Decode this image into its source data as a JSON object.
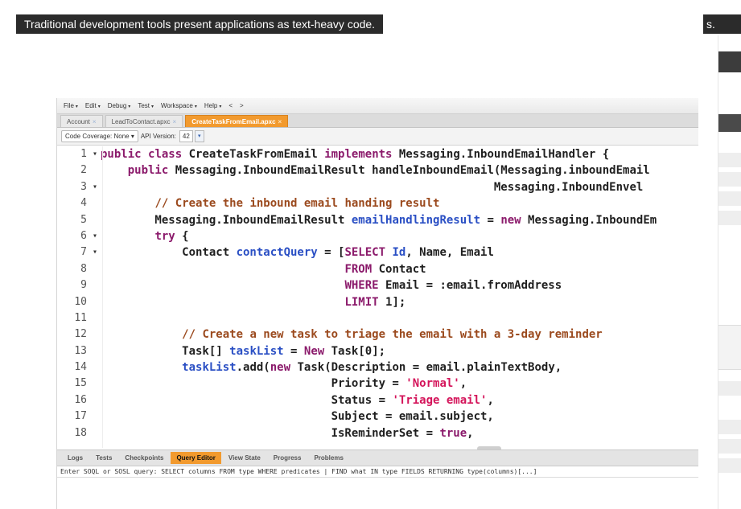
{
  "caption": {
    "text": "Traditional development tools present applications as text-heavy code.",
    "right_fragment": "s."
  },
  "menubar": {
    "items": [
      {
        "label": "File",
        "caret": "▾"
      },
      {
        "label": "Edit",
        "caret": "▾"
      },
      {
        "label": "Debug",
        "caret": "▾"
      },
      {
        "label": "Test",
        "caret": "▾"
      },
      {
        "label": "Workspace",
        "caret": "▾"
      },
      {
        "label": "Help",
        "caret": "▾"
      }
    ],
    "back_arrow": "<",
    "forward_arrow": ">"
  },
  "tabs": [
    {
      "label": "Account",
      "close": "×",
      "active": false
    },
    {
      "label": "LeadToContact.apxc",
      "close": "×",
      "active": false
    },
    {
      "label": "CreateTaskFromEmail.apxc",
      "close": "×",
      "active": true
    }
  ],
  "toolbar": {
    "coverage_select": "Code Coverage: None ▾",
    "api_label": "API Version:",
    "api_value": "42",
    "api_drop": "▾"
  },
  "code_lines": [
    {
      "n": "1",
      "fold": "▾",
      "text": "public class CreateTaskFromEmail implements Messaging.InboundEmailHandler {"
    },
    {
      "n": "2",
      "fold": "",
      "text": "    public Messaging.InboundEmailResult handleInboundEmail(Messaging.inboundEmail"
    },
    {
      "n": "3",
      "fold": "▾",
      "text": "                                                          Messaging.InboundEnvel"
    },
    {
      "n": "4",
      "fold": "",
      "text": "        // Create the inbound email handing result"
    },
    {
      "n": "5",
      "fold": "",
      "text": "        Messaging.InboundEmailResult emailHandlingResult = new Messaging.InboundEm"
    },
    {
      "n": "6",
      "fold": "▾",
      "text": "        try {"
    },
    {
      "n": "7",
      "fold": "▾",
      "text": "            Contact contactQuery = [SELECT Id, Name, Email"
    },
    {
      "n": "8",
      "fold": "",
      "text": "                                    FROM Contact"
    },
    {
      "n": "9",
      "fold": "",
      "text": "                                    WHERE Email = :email.fromAddress"
    },
    {
      "n": "10",
      "fold": "",
      "text": "                                    LIMIT 1];"
    },
    {
      "n": "11",
      "fold": "",
      "text": ""
    },
    {
      "n": "12",
      "fold": "",
      "text": "            // Create a new task to triage the email with a 3-day reminder"
    },
    {
      "n": "13",
      "fold": "",
      "text": "            Task[] taskList = New Task[0];"
    },
    {
      "n": "14",
      "fold": "",
      "text": "            taskList.add(new Task(Description = email.plainTextBody,"
    },
    {
      "n": "15",
      "fold": "",
      "text": "                                  Priority = 'Normal',"
    },
    {
      "n": "16",
      "fold": "",
      "text": "                                  Status = 'Triage email',"
    },
    {
      "n": "17",
      "fold": "",
      "text": "                                  Subject = email.subject,"
    },
    {
      "n": "18",
      "fold": "",
      "text": "                                  IsReminderSet = true,"
    }
  ],
  "bottom_tabs": [
    {
      "label": "Logs",
      "active": false
    },
    {
      "label": "Tests",
      "active": false
    },
    {
      "label": "Checkpoints",
      "active": false
    },
    {
      "label": "Query Editor",
      "active": true
    },
    {
      "label": "View State",
      "active": false
    },
    {
      "label": "Progress",
      "active": false
    },
    {
      "label": "Problems",
      "active": false
    }
  ],
  "query_bar": {
    "text": "Enter SOQL or SOSL query: SELECT columns FROM type WHERE predicates | FIND what IN type FIELDS RETURNING type(columns)[...]"
  },
  "colors": {
    "keyword": "#8b1a6b",
    "comment": "#9b4a1e",
    "string": "#d4145a",
    "identifier": "#2a4fc4",
    "tab_active": "#f29a2e"
  }
}
